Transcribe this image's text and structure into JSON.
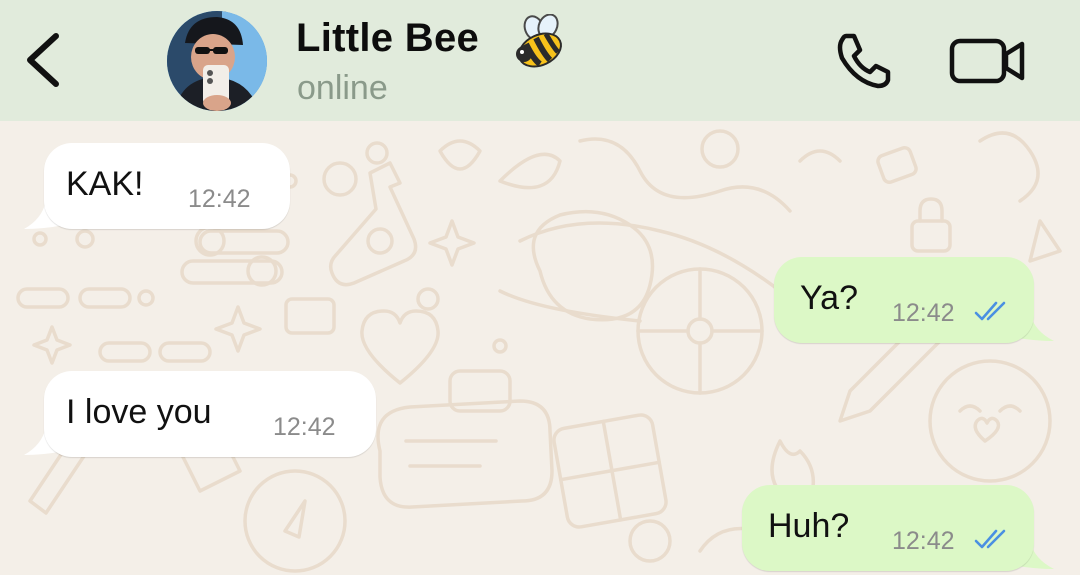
{
  "header": {
    "back_icon": "chevron-left-icon",
    "contact_name": "Little Bee",
    "contact_emoji": "bee-emoji-icon",
    "status": "online",
    "call_icon": "phone-icon",
    "video_icon": "video-camera-icon"
  },
  "messages": [
    {
      "direction": "incoming",
      "text": "KAK!",
      "time": "12:42"
    },
    {
      "direction": "outgoing",
      "text": "Ya?",
      "time": "12:42",
      "receipt": "read"
    },
    {
      "direction": "incoming",
      "text": "I love you",
      "time": "12:42"
    },
    {
      "direction": "outgoing",
      "text": "Huh?",
      "time": "12:42",
      "receipt": "read"
    }
  ],
  "colors": {
    "header_bg": "#e1ebdc",
    "wallpaper_bg": "#f4efe8",
    "incoming_bubble": "#ffffff",
    "outgoing_bubble": "#dcf8c6",
    "read_ticks": "#4a90e2"
  }
}
